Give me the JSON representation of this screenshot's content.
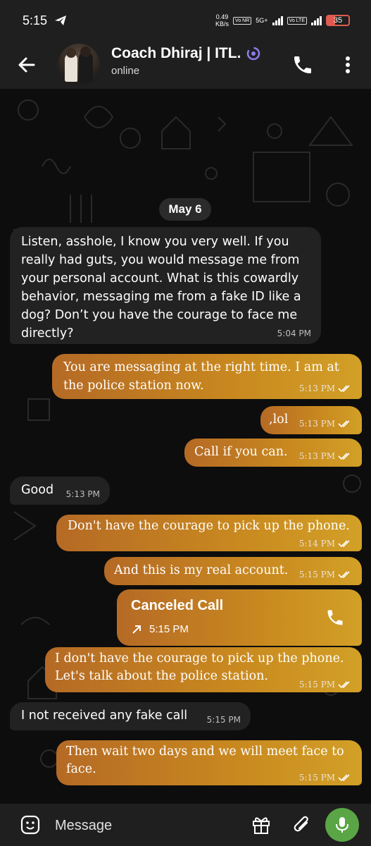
{
  "status_bar": {
    "time": "5:15",
    "net_speed_value": "0.49",
    "net_speed_unit": "KB/s",
    "chip_vo_nr": "Vo NR",
    "network_5g": "5G+",
    "chip_vo_lte": "Vo LTE",
    "battery": "35"
  },
  "header": {
    "contact_name": "Coach Dhiraj | ITL.",
    "contact_status": "online"
  },
  "chat": {
    "date_label": "May 6",
    "messages": [
      {
        "text": "Listen, asshole, I know you very well. If you really had guts, you would message me from your personal account. What is this cowardly behavior, messaging me from a fake ID like a dog? Don’t you have the courage to face me directly?",
        "time": "5:04 PM"
      },
      {
        "text": "You are messaging at the right time. I am at the police station now.",
        "time": "5:13 PM"
      },
      {
        "text": ",lol",
        "time": "5:13 PM"
      },
      {
        "text": "Call if you can.",
        "time": "5:13 PM"
      },
      {
        "text": "Good",
        "time": "5:13 PM"
      },
      {
        "text": "Don't have the courage to pick up the phone.",
        "time": "5:14 PM"
      },
      {
        "text": "And this is my real account.",
        "time": "5:15 PM"
      },
      {
        "call_label": "Canceled Call",
        "time": "5:15 PM"
      },
      {
        "text": "I don't have the courage to pick up the phone. Let's talk about the police station.",
        "time": "5:15 PM"
      },
      {
        "text": "I not received any fake call",
        "time": "5:15 PM"
      },
      {
        "text": "Then wait two days and we will meet face to face.",
        "time": "5:15 PM"
      }
    ]
  },
  "composer": {
    "placeholder": "Message"
  },
  "colors": {
    "header_bg": "#1f1f1f",
    "incoming_bubble": "#222222",
    "outgoing_gradient_start": "#b56a25",
    "outgoing_gradient_end": "#d2a027",
    "mic_button": "#5aa545",
    "battery_low": "#e05b4f"
  },
  "icons": [
    "send-status-icon",
    "back-arrow-icon",
    "verified-badge-icon",
    "phone-icon",
    "more-vert-icon",
    "double-check-icon",
    "outgoing-call-arrow-icon",
    "emoji-sticker-icon",
    "gift-icon",
    "attach-icon",
    "mic-icon"
  ]
}
